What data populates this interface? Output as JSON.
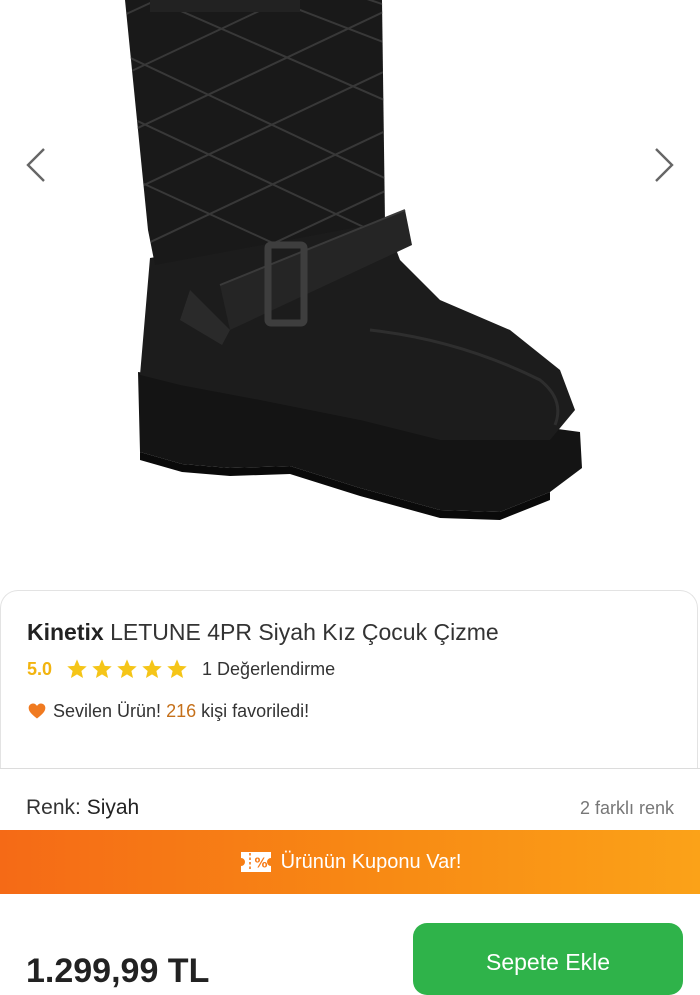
{
  "product": {
    "brand": "Kinetix",
    "name": "LETUNE 4PR Siyah Kız Çocuk Çizme",
    "rating_score": "5.0",
    "rating_stars": 5,
    "review_count_text": "1 Değerlendirme",
    "favorite_prefix": "Sevilen Ürün!",
    "favorite_count": "216",
    "favorite_suffix": "kişi favoriledi!"
  },
  "color": {
    "label": "Renk:",
    "value": "Siyah",
    "options_text": "2 farklı renk"
  },
  "coupon": {
    "text": "Ürünün Kuponu Var!"
  },
  "purchase": {
    "price": "1.299,99 TL",
    "add_to_cart_label": "Sepete Ekle"
  },
  "icons": {
    "prev": "chevron-left-icon",
    "next": "chevron-right-icon",
    "star": "star-icon",
    "heart": "heart-icon",
    "coupon": "coupon-ticket-icon"
  },
  "colors": {
    "star": "#f5c518",
    "rating_score": "#f2b40f",
    "heart": "#f07a20",
    "favorite_count": "#c5701a",
    "coupon_start": "#f56a16",
    "coupon_end": "#fba218",
    "cart_button": "#2fb34a"
  }
}
